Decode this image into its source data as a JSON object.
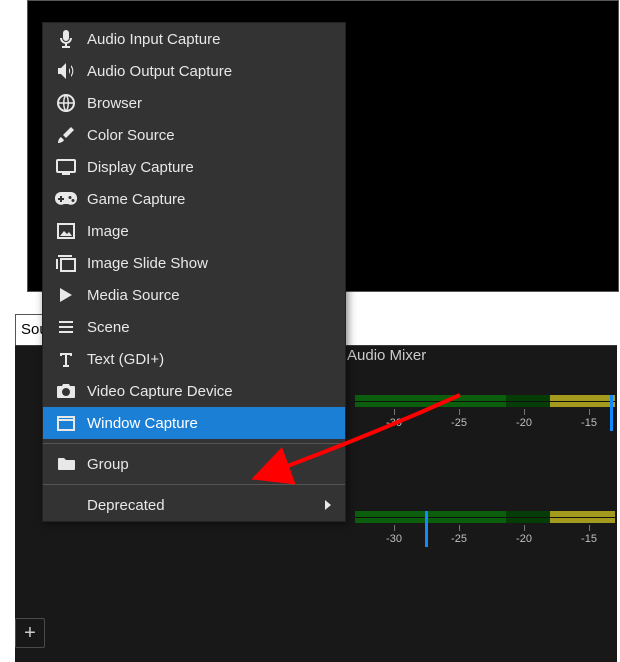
{
  "panels": {
    "sources_tab_label": "Sources",
    "mixer_title": "Audio Mixer"
  },
  "add_button_glyph": "+",
  "meter_ticks": [
    "-30",
    "-25",
    "-20",
    "-15"
  ],
  "menu": {
    "items": [
      {
        "id": "audio-input-capture",
        "label": "Audio Input Capture",
        "icon": "mic"
      },
      {
        "id": "audio-output-capture",
        "label": "Audio Output Capture",
        "icon": "speaker"
      },
      {
        "id": "browser",
        "label": "Browser",
        "icon": "globe"
      },
      {
        "id": "color-source",
        "label": "Color Source",
        "icon": "brush"
      },
      {
        "id": "display-capture",
        "label": "Display Capture",
        "icon": "monitor"
      },
      {
        "id": "game-capture",
        "label": "Game Capture",
        "icon": "gamepad"
      },
      {
        "id": "image",
        "label": "Image",
        "icon": "image"
      },
      {
        "id": "image-slide-show",
        "label": "Image Slide Show",
        "icon": "slides"
      },
      {
        "id": "media-source",
        "label": "Media Source",
        "icon": "play"
      },
      {
        "id": "scene",
        "label": "Scene",
        "icon": "list"
      },
      {
        "id": "text-gdi",
        "label": "Text (GDI+)",
        "icon": "text"
      },
      {
        "id": "video-capture-device",
        "label": "Video Capture Device",
        "icon": "camera"
      },
      {
        "id": "window-capture",
        "label": "Window Capture",
        "icon": "window",
        "selected": true
      }
    ],
    "group_label": "Group",
    "deprecated_label": "Deprecated"
  },
  "colors": {
    "highlight": "#1b7fd6",
    "arrow": "#ff0000"
  }
}
